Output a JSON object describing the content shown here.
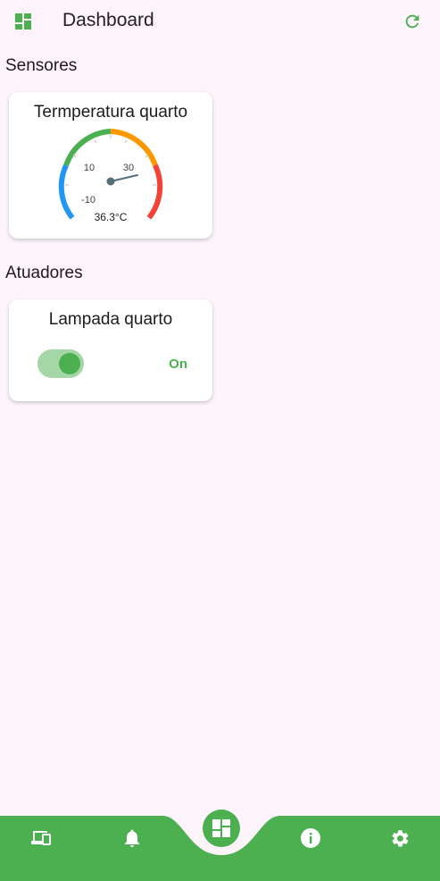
{
  "app_bar": {
    "title": "Dashboard",
    "menu_icon": "dashboard-icon",
    "refresh_icon": "refresh-icon",
    "accent_color": "#4caf50"
  },
  "sensors": {
    "section_title": "Sensores",
    "temperature_card": {
      "title": "Termperatura quarto",
      "value_label": "36.3°C",
      "value": 36.3,
      "tick_labels": [
        "-10",
        "10",
        "30"
      ],
      "colors": {
        "cold": "#2196f3",
        "normal": "#4caf50",
        "warm": "#ff9800",
        "hot": "#f44336",
        "needle": "#546e7a"
      }
    }
  },
  "actuators": {
    "section_title": "Atuadores",
    "lamp_card": {
      "title": "Lampada quarto",
      "state_label": "On",
      "is_on": true
    }
  },
  "bottom_nav": {
    "items": [
      {
        "icon": "devices-icon"
      },
      {
        "icon": "notifications-icon"
      },
      {
        "icon": "dashboard-icon",
        "active": true
      },
      {
        "icon": "info-icon"
      },
      {
        "icon": "settings-icon"
      }
    ],
    "color": "#4caf50"
  }
}
